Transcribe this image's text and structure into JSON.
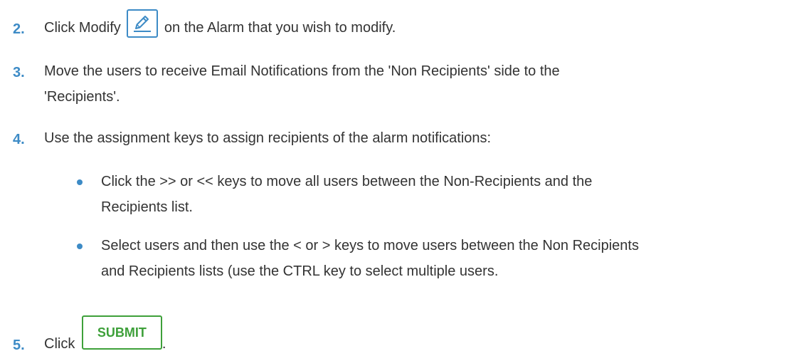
{
  "steps": [
    {
      "number": "2.",
      "before_icon": "Click Modify",
      "icon": "pencil-edit-icon",
      "after_icon": "on the Alarm that you wish to modify."
    },
    {
      "number": "3.",
      "line1": "Move the users to receive Email Notifications from the 'Non Recipients' side to the",
      "line2": "'Recipients'."
    },
    {
      "number": "4.",
      "text": "Use the assignment keys to assign recipients of the alarm notifications:",
      "bullets": [
        {
          "line1": "Click the >> or << keys to move all users between the Non-Recipients and the",
          "line2": "Recipients list."
        },
        {
          "line1": "Select users and then use the < or > keys to move users between the Non Recipients",
          "line2": "and Recipients lists (use the CTRL key to select multiple users."
        }
      ]
    },
    {
      "number": "5.",
      "before_button": "Click",
      "button_label": "SUBMIT",
      "after_button": "."
    }
  ],
  "colors": {
    "step_number": "#3d8bc6",
    "edit_icon": "#3d8bc6",
    "submit_button": "#3ea03a",
    "text": "#333333"
  }
}
